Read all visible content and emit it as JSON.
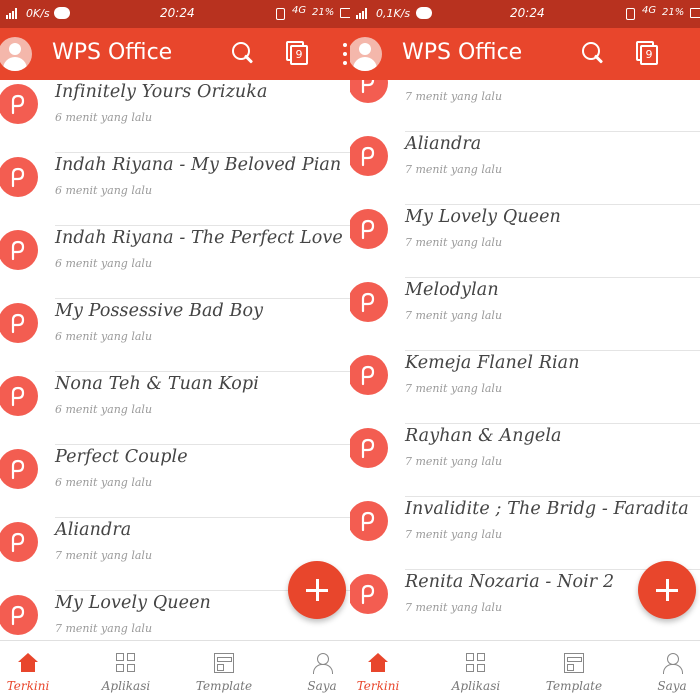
{
  "status_left": {
    "speed": "0K/s",
    "time": "20:24",
    "network": "4G",
    "battery": "21%"
  },
  "status_right": {
    "speed": "0,1K/s",
    "time": "20:24",
    "network": "4G",
    "battery": "21%"
  },
  "appbar": {
    "title": "WPS Office",
    "tab_count": "9"
  },
  "left_list": [
    {
      "name": "Infinitely Yours  Orizuka",
      "meta": "6 menit yang lalu"
    },
    {
      "name": "Indah Riyana - My Beloved Pian",
      "meta": "6 menit yang lalu"
    },
    {
      "name": "Indah Riyana - The Perfect Love",
      "meta": "6 menit yang lalu"
    },
    {
      "name": "My Possessive Bad Boy",
      "meta": "6 menit yang lalu"
    },
    {
      "name": "Nona Teh & Tuan Kopi",
      "meta": "6 menit yang lalu"
    },
    {
      "name": "Perfect Couple",
      "meta": "6 menit yang lalu"
    },
    {
      "name": "Aliandra",
      "meta": "7 menit yang lalu"
    },
    {
      "name": "My Lovely Queen",
      "meta": "7 menit yang lalu"
    }
  ],
  "right_list": [
    {
      "name": "",
      "meta": "7 menit yang lalu"
    },
    {
      "name": "Aliandra",
      "meta": "7 menit yang lalu"
    },
    {
      "name": "My Lovely Queen",
      "meta": "7 menit yang lalu"
    },
    {
      "name": "Melodylan",
      "meta": "7 menit yang lalu"
    },
    {
      "name": "Kemeja Flanel Rian",
      "meta": "7 menit yang lalu"
    },
    {
      "name": "Rayhan & Angela",
      "meta": "7 menit yang lalu"
    },
    {
      "name": "Invalidite ; The Bridg - Faradita",
      "meta": "7 menit yang lalu"
    },
    {
      "name": "Renita Nozaria - Noir 2",
      "meta": "7 menit yang lalu"
    }
  ],
  "nav": {
    "recent": "Terkini",
    "apps": "Aplikasi",
    "template": "Template",
    "me": "Saya"
  },
  "colors": {
    "statusbar": "#b8321f",
    "appbar": "#e8462c",
    "doc_icon": "#f35d51",
    "accent": "#e8462c"
  }
}
